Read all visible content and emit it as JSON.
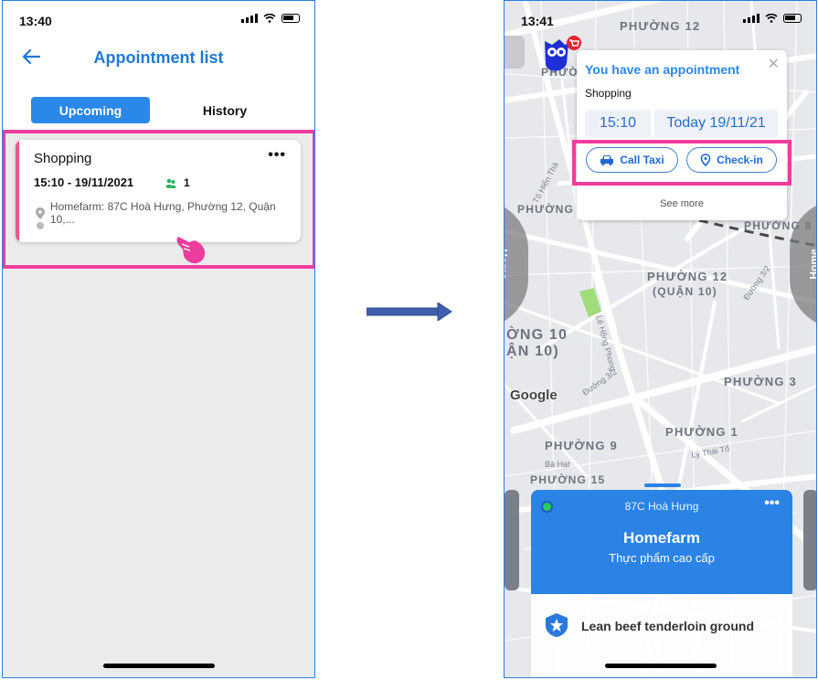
{
  "left_screen": {
    "status_time": "13:40",
    "title": "Appointment list",
    "tabs": [
      {
        "label": "Upcoming"
      },
      {
        "label": "History"
      }
    ],
    "card": {
      "name": "Shopping",
      "datetime": "15:10 - 19/11/2021",
      "people_count": "1",
      "address": "Homefarm: 87C Hoà Hưng, Phường 12, Quận 10,..."
    }
  },
  "right_screen": {
    "status_time": "13:41",
    "popup": {
      "title": "You have an appointment",
      "category": "Shopping",
      "time": "15:10",
      "date": "Today 19/11/21",
      "call_taxi": "Call Taxi",
      "check_in": "Check-in",
      "see_more": "See more"
    },
    "side_label": "Home",
    "map_labels": {
      "phuong_12_top": "PHƯỜNG 12",
      "phuong_12_q10": "PHƯỜNG 12",
      "quan_10_small": "(QUẬN 10)",
      "phuong_8": "PHƯỜNG 8",
      "phuong_10": "ỜNG 10",
      "quan_10": "ẬN 10)",
      "phuong_3": "PHƯỜNG 3",
      "phuong_1": "PHƯỜNG 1",
      "phuong_9": "PHƯỜNG 9",
      "phuong_15": "PHƯỜNG 15",
      "to_hien_thanh": "Tô Hiến Thà",
      "le_hong_phong": "Lê Hồng Phong",
      "duong_32": "Đường 3/2",
      "duong_32_b": "Đường 3/2",
      "ly_thai_to": "Lý Thái Tổ",
      "ba_hat": "Bà Hạt",
      "phuong_top_left": "PHƯỜNG",
      "phuong_left": "PHƯỜNG",
      "google": "Google"
    },
    "cart_badge_icon": "cart-icon",
    "sheet": {
      "address": "87C Hoà Hưng",
      "store": "Homefarm",
      "tagline": "Thực phẩm cao cấp",
      "product": "Lean beef tenderloin ground"
    }
  },
  "colors": {
    "accent": "#2a88e8",
    "highlight": "#f03d9b",
    "stripe": "#e85a87",
    "sheet_blue": "#2b83e5"
  }
}
